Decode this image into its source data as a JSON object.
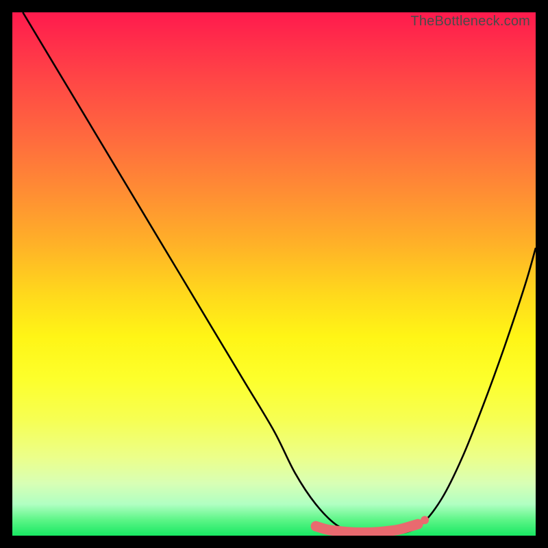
{
  "watermark": "TheBottleneck.com",
  "chart_data": {
    "type": "line",
    "title": "",
    "xlabel": "",
    "ylabel": "",
    "xlim": [
      0,
      100
    ],
    "ylim": [
      0,
      100
    ],
    "grid": false,
    "x": [
      2,
      8,
      14,
      20,
      26,
      32,
      38,
      44,
      50,
      54,
      58,
      62,
      66,
      70,
      74,
      78,
      82,
      86,
      90,
      94,
      98,
      100
    ],
    "values": [
      100,
      90,
      80,
      70,
      60,
      50,
      40,
      30,
      20,
      12,
      6,
      2,
      0.4,
      0.4,
      0.4,
      2,
      7,
      15,
      25,
      36,
      48,
      55
    ],
    "marker_overlay": {
      "color": "#e96a6f",
      "x": [
        58,
        60,
        62,
        64,
        66,
        68,
        70,
        72,
        74,
        77.5
      ],
      "y": [
        1.8,
        1.2,
        0.9,
        0.7,
        0.6,
        0.6,
        0.7,
        0.9,
        1.2,
        2.2
      ]
    }
  }
}
